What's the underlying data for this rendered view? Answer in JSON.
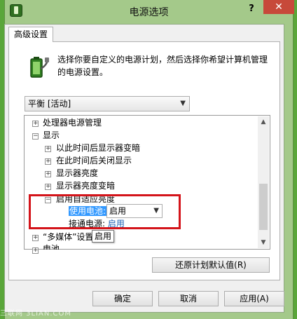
{
  "window": {
    "title": "电源选项",
    "help": "?",
    "close": "✕"
  },
  "tab": {
    "label": "高级设置"
  },
  "description": "选择你要自定义的电源计划，然后选择你希望计算机管理的电源设置。",
  "plan_select": {
    "value": "平衡 [活动]"
  },
  "tree": {
    "items": [
      {
        "label": "处理器电源管理",
        "expander": "+"
      },
      {
        "label": "显示",
        "expander": "−"
      },
      {
        "label": "以此时间后显示器变暗",
        "expander": "+"
      },
      {
        "label": "在此时间后关闭显示",
        "expander": "+"
      },
      {
        "label": "显示器亮度",
        "expander": "+"
      },
      {
        "label": "显示器亮度变暗",
        "expander": "+"
      },
      {
        "label": "启用自适应亮度",
        "expander": "−"
      },
      {
        "label": "“多媒体”设置",
        "expander": "+"
      },
      {
        "label": "电池",
        "expander": "+"
      }
    ],
    "battery_setting": {
      "label": "使用电池:",
      "value": "启用"
    },
    "plugged_setting": {
      "label": "接通电源:",
      "value": "启用"
    },
    "tooltip": "启用"
  },
  "buttons": {
    "restore": "还原计划默认值(R)",
    "ok": "确定",
    "cancel": "取消",
    "apply": "应用(A)"
  },
  "watermark": "三联网 3LIAN.COM",
  "colors": {
    "highlight_box": "#d4141a",
    "link": "#1a5fb4",
    "selection": "#3399ff",
    "close": "#c7493a"
  }
}
